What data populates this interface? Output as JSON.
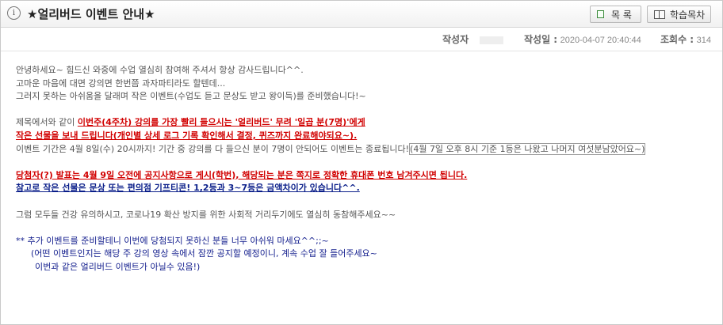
{
  "header": {
    "info_glyph": "i",
    "title": "★얼리버드 이벤트 안내★",
    "list_button": "목 록",
    "course_button": "학습목차"
  },
  "meta": {
    "writer_label": "작성자",
    "date_label": "작성일 :",
    "date_value": "2020-04-07 20:40:44",
    "views_label": "조회수 :",
    "views_value": "314"
  },
  "content": {
    "l1": "안녕하세요~ 힘드신 와중에 수업 열심히 참여해 주셔서 항상 감사드립니다^^.",
    "l2": "고마운 마음에 대면 강의면 한번쯤 과자파티라도 할텐데...",
    "l3": "그러지 못하는 아쉬움을 달래며 작은 이벤트(수업도 듣고 문상도 받고 왕이득)를 준비했습니다!~",
    "l4a": "제목에서와 같이 ",
    "l4b": "이번주(4주차) 강의를 가장 빨리 들으시는 '얼리버드' 무려 '일곱 분(7명)'에게",
    "l5": "작은 선물을 보내 드립니다(개인별 상세 로그 기록 확인해서 결정, 퀴즈까지 완료해야되요~).",
    "l6a": "이벤트 기간은 4월 8일(수) 20시까지! 기간 중 강의를 다 들으신 분이 7명이 안되어도 이벤트는 종료됩니다!",
    "l6b": "(4월 7일 오후 8시 기준 1등은 나왔고 나머지 여섯분남았어요~)",
    "l7": "당첨자(?) 발표는 4월 9일 오전에 공지사항으로 게시(학번), 해당되는 분은 쪽지로 정확한 휴대폰 번호 남겨주시면 됩니다.",
    "l8": "참고로 작은 선물은 문상 또는 편의점 기프티콘! 1,2등과 3~7등은 금액차이가 있습니다^^.",
    "l9": "그럼 모두들 건강 유의하시고, 코로나19 확산 방지를 위한 사회적 거리두기에도 열심히 동참해주세요~~",
    "l10": "** 추가 이벤트를 준비할테니 이번에 당첨되지 못하신 분들 너무 아쉬워 마세요^^;;~",
    "l11": "(어떤 이벤트인지는 해당 주 강의 영상 속에서 잠깐 공지할 예정이니, 계속 수업 잘 들어주세요~",
    "l12": "이번과 같은 얼리버드 이벤트가 아닐수 있음!)"
  }
}
